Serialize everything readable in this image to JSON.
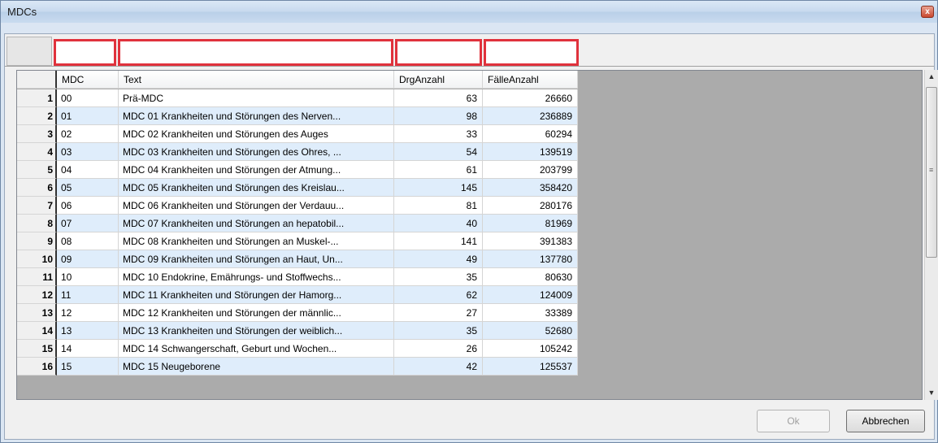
{
  "window": {
    "title": "MDCs",
    "close_label": "x"
  },
  "columns": [
    "MDC",
    "Text",
    "DrgAnzahl",
    "FälleAnzahl"
  ],
  "rows": [
    {
      "n": "1",
      "mdc": "00",
      "text": "Prä-MDC",
      "drg": "63",
      "faelle": "26660"
    },
    {
      "n": "2",
      "mdc": "01",
      "text": "MDC 01 Krankheiten und Störungen des Nerven...",
      "drg": "98",
      "faelle": "236889"
    },
    {
      "n": "3",
      "mdc": "02",
      "text": "MDC 02 Krankheiten und Störungen des Auges",
      "drg": "33",
      "faelle": "60294"
    },
    {
      "n": "4",
      "mdc": "03",
      "text": "MDC 03 Krankheiten und Störungen des Ohres, ...",
      "drg": "54",
      "faelle": "139519"
    },
    {
      "n": "5",
      "mdc": "04",
      "text": "MDC 04 Krankheiten und Störungen der Atmung...",
      "drg": "61",
      "faelle": "203799"
    },
    {
      "n": "6",
      "mdc": "05",
      "text": "MDC 05 Krankheiten und Störungen des Kreislau...",
      "drg": "145",
      "faelle": "358420"
    },
    {
      "n": "7",
      "mdc": "06",
      "text": "MDC 06 Krankheiten und Störungen der Verdauu...",
      "drg": "81",
      "faelle": "280176"
    },
    {
      "n": "8",
      "mdc": "07",
      "text": "MDC 07 Krankheiten und Störungen an hepatobil...",
      "drg": "40",
      "faelle": "81969"
    },
    {
      "n": "9",
      "mdc": "08",
      "text": "MDC 08 Krankheiten und Störungen an Muskel-...",
      "drg": "141",
      "faelle": "391383"
    },
    {
      "n": "10",
      "mdc": "09",
      "text": "MDC 09 Krankheiten und Störungen an Haut, Un...",
      "drg": "49",
      "faelle": "137780"
    },
    {
      "n": "11",
      "mdc": "10",
      "text": "MDC 10 Endokrine, Emährungs- und Stoffwechs...",
      "drg": "35",
      "faelle": "80630"
    },
    {
      "n": "12",
      "mdc": "11",
      "text": "MDC 11 Krankheiten und Störungen der Hamorg...",
      "drg": "62",
      "faelle": "124009"
    },
    {
      "n": "13",
      "mdc": "12",
      "text": "MDC 12 Krankheiten und Störungen der männlic...",
      "drg": "27",
      "faelle": "33389"
    },
    {
      "n": "14",
      "mdc": "13",
      "text": "MDC 13 Krankheiten und Störungen der weiblich...",
      "drg": "35",
      "faelle": "52680"
    },
    {
      "n": "15",
      "mdc": "14",
      "text": "MDC 14 Schwangerschaft, Geburt und Wochen...",
      "drg": "26",
      "faelle": "105242"
    },
    {
      "n": "16",
      "mdc": "15",
      "text": "MDC 15 Neugeborene",
      "drg": "42",
      "faelle": "125537"
    }
  ],
  "buttons": {
    "ok": "Ok",
    "cancel": "Abbrechen"
  },
  "icons": {
    "close": "close-icon",
    "scroll_up": "scroll-up-arrow-icon",
    "scroll_down": "scroll-down-arrow-icon"
  },
  "colors": {
    "filter_border": "#e0323c",
    "alt_row": "#dfedfb",
    "grid_bg": "#ababab"
  }
}
